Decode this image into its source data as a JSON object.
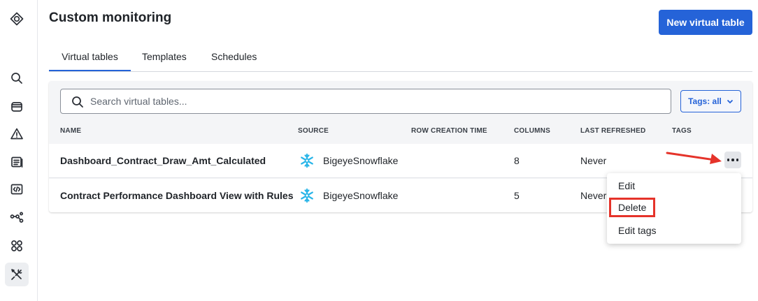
{
  "app": {
    "logo_icon": "diamond-logo-icon"
  },
  "sidebar": {
    "items": [
      {
        "icon": "search-icon"
      },
      {
        "icon": "database-icon"
      },
      {
        "icon": "warning-icon"
      },
      {
        "icon": "catalog-icon"
      },
      {
        "icon": "code-file-icon"
      },
      {
        "icon": "lineage-icon"
      },
      {
        "icon": "grid-apps-icon"
      },
      {
        "icon": "tools-icon",
        "active": true
      }
    ]
  },
  "header": {
    "title": "Custom monitoring",
    "primary_button": "New virtual table"
  },
  "tabs": [
    {
      "label": "Virtual tables",
      "active": true
    },
    {
      "label": "Templates"
    },
    {
      "label": "Schedules"
    }
  ],
  "search": {
    "placeholder": "Search virtual tables..."
  },
  "filter": {
    "tags_label": "Tags: all"
  },
  "table": {
    "columns": [
      "NAME",
      "SOURCE",
      "ROW CREATION TIME",
      "COLUMNS",
      "LAST REFRESHED",
      "TAGS"
    ],
    "rows": [
      {
        "name": "Dashboard_Contract_Draw_Amt_Calculated",
        "source": "BigeyeSnowflake",
        "row_creation_time": "",
        "columns": "8",
        "last_refreshed": "Never",
        "tags": ""
      },
      {
        "name": "Contract Performance Dashboard View with Rules",
        "source": "BigeyeSnowflake",
        "row_creation_time": "",
        "columns": "5",
        "last_refreshed": "Never",
        "tags": ""
      }
    ]
  },
  "row_menu": {
    "items": [
      "Edit",
      "Delete",
      "Edit tags"
    ],
    "highlighted": "Delete"
  },
  "colors": {
    "primary": "#2563d8",
    "annotation": "#e5332a",
    "snowflake": "#29b5e8"
  }
}
